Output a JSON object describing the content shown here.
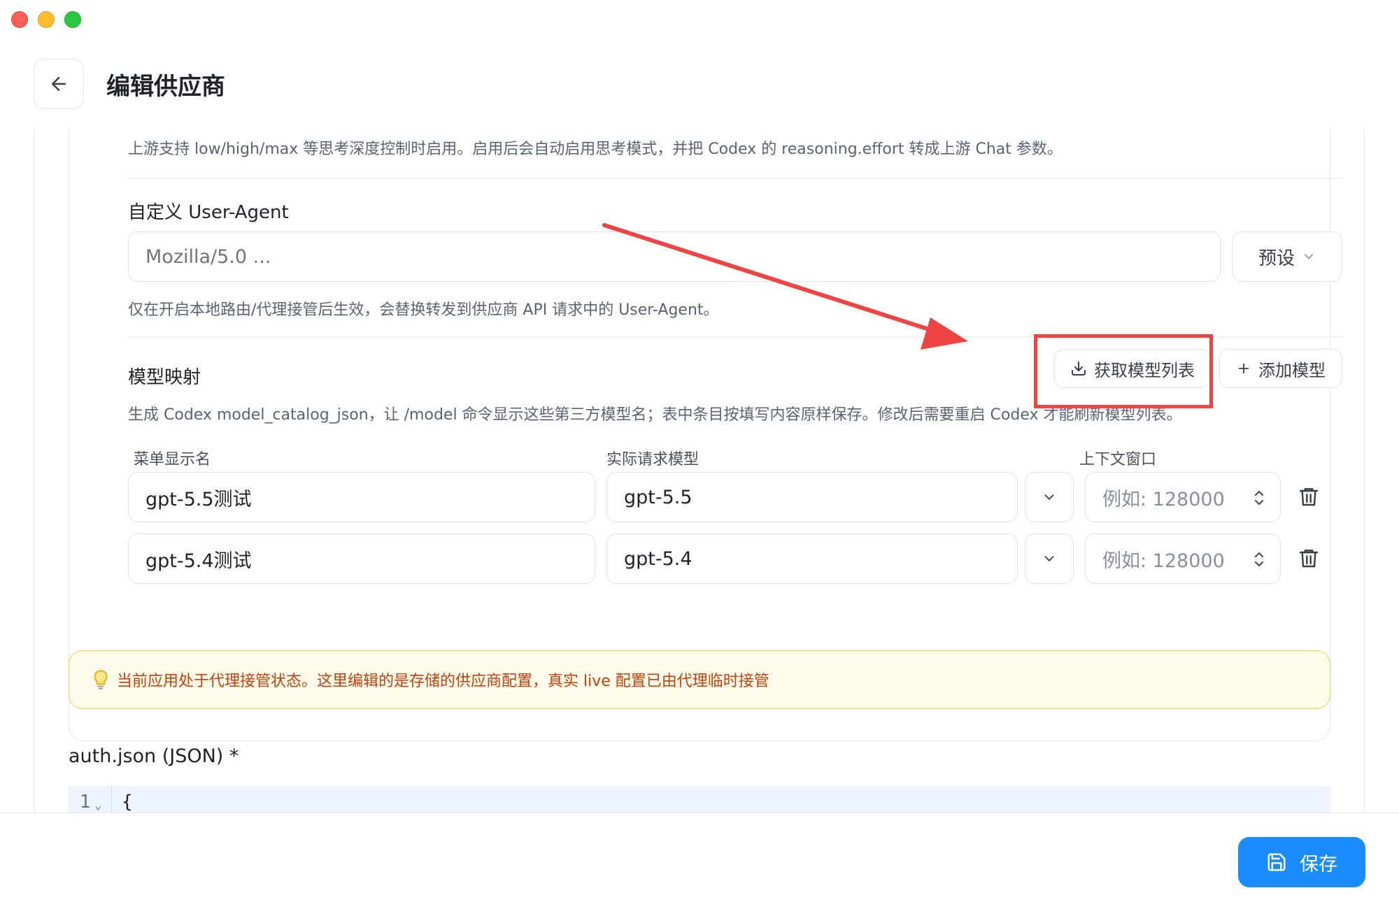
{
  "window": {
    "controls": [
      "close",
      "minimize",
      "zoom"
    ]
  },
  "header": {
    "back_icon": "arrow-left-icon",
    "title": "编辑供应商"
  },
  "reasoning_section": {
    "description": "上游支持 low/high/max 等思考深度控制时启用。启用后会自动启用思考模式，并把 Codex 的 reasoning.effort 转成上游 Chat 参数。",
    "toggle_on": true
  },
  "user_agent": {
    "label": "自定义 User-Agent",
    "placeholder": "Mozilla/5.0 ...",
    "value": "",
    "preset_label": "预设",
    "help": "仅在开启本地路由/代理接管后生效，会替换转发到供应商 API 请求中的 User-Agent。"
  },
  "model_mapping": {
    "label": "模型映射",
    "fetch_button": "获取模型列表",
    "add_button": "添加模型",
    "help": "生成 Codex model_catalog_json，让 /model 命令显示这些第三方模型名；表中条目按填写内容原样保存。修改后需要重启 Codex 才能刷新模型列表。",
    "columns": {
      "display_name": "菜单显示名",
      "actual_model": "实际请求模型",
      "context_window": "上下文窗口"
    },
    "rows": [
      {
        "display_name": "gpt-5.5测试",
        "actual_model": "gpt-5.5",
        "context_placeholder": "例如: 128000"
      },
      {
        "display_name": "gpt-5.4测试",
        "actual_model": "gpt-5.4",
        "context_placeholder": "例如: 128000"
      }
    ]
  },
  "notice": {
    "icon": "lightbulb-icon",
    "text": "当前应用处于代理接管状态。这里编辑的是存储的供应商配置，真实 live 配置已由代理临时接管"
  },
  "auth_json": {
    "label": "auth.json (JSON) *",
    "line_number": "1",
    "first_line": "{"
  },
  "footer": {
    "save_label": "保存"
  },
  "colors": {
    "accent": "#1a8cff",
    "toggle_on": "#1fb97b",
    "annotation_red": "#ee4444",
    "notice_text": "#c2410c",
    "notice_bg": "#fffbeb"
  }
}
